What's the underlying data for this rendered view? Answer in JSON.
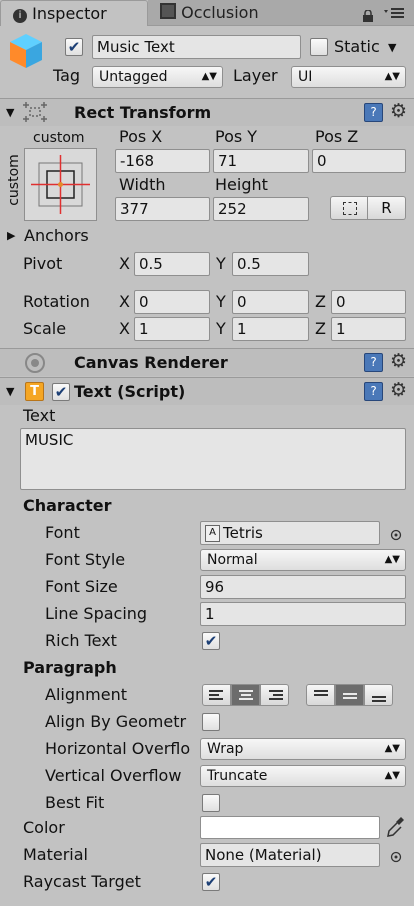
{
  "tabs": {
    "inspector": "Inspector",
    "occlusion": "Occlusion"
  },
  "object": {
    "name": "Music Text",
    "active": true,
    "static_label": "Static",
    "static_checked": false,
    "tag_label": "Tag",
    "tag_value": "Untagged",
    "layer_label": "Layer",
    "layer_value": "UI"
  },
  "rect_transform": {
    "title": "Rect Transform",
    "anchor_preset_top": "custom",
    "anchor_preset_side": "custom",
    "pos_x_label": "Pos X",
    "pos_y_label": "Pos Y",
    "pos_z_label": "Pos Z",
    "pos_x": "-168",
    "pos_y": "71",
    "pos_z": "0",
    "width_label": "Width",
    "height_label": "Height",
    "width": "377",
    "height": "252",
    "r_button": "R",
    "anchors_label": "Anchors",
    "pivot_label": "Pivot",
    "pivot_x": "0.5",
    "pivot_y": "0.5",
    "rotation_label": "Rotation",
    "rot_x": "0",
    "rot_y": "0",
    "rot_z": "0",
    "scale_label": "Scale",
    "scale_x": "1",
    "scale_y": "1",
    "scale_z": "1",
    "x": "X",
    "y": "Y",
    "z": "Z"
  },
  "canvas_renderer": {
    "title": "Canvas Renderer"
  },
  "text_script": {
    "title": "Text (Script)",
    "enabled": true,
    "text_label": "Text",
    "text_value": "MUSIC",
    "character_header": "Character",
    "font_label": "Font",
    "font_value": "Tetris",
    "font_style_label": "Font Style",
    "font_style_value": "Normal",
    "font_size_label": "Font Size",
    "font_size_value": "96",
    "line_spacing_label": "Line Spacing",
    "line_spacing_value": "1",
    "rich_text_label": "Rich Text",
    "rich_text_checked": true,
    "paragraph_header": "Paragraph",
    "alignment_label": "Alignment",
    "align_by_geometry_label": "Align By Geometr",
    "align_by_geometry_checked": false,
    "horizontal_overflow_label": "Horizontal Overflo",
    "horizontal_overflow_value": "Wrap",
    "vertical_overflow_label": "Vertical Overflow",
    "vertical_overflow_value": "Truncate",
    "best_fit_label": "Best Fit",
    "best_fit_checked": false,
    "color_label": "Color",
    "color_value": "#ffffff",
    "material_label": "Material",
    "material_value": "None (Material)",
    "raycast_label": "Raycast Target",
    "raycast_checked": true
  },
  "icons": {
    "inspector_tab": "info-icon",
    "occlusion_tab": "occlusion-icon",
    "lock": "lock-icon",
    "menu": "tab-menu-icon",
    "cube": "gameobject-cube-icon",
    "rect": "rect-transform-icon",
    "canvas": "canvas-renderer-icon",
    "text": "text-component-icon",
    "book": "help-book-icon",
    "gear": "gear-icon",
    "target": "object-picker-icon",
    "eyedropper": "eyedropper-icon"
  }
}
